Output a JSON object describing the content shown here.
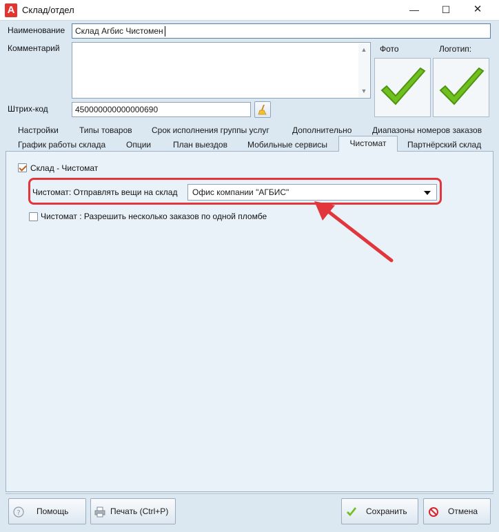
{
  "window": {
    "title": "Склад/отдел",
    "minimize_glyph": "—",
    "maximize_glyph": "☐",
    "close_glyph": "✕"
  },
  "form": {
    "name_label": "Наименование",
    "name_value": "Склад Агбис Чистомен",
    "comment_label": "Комментарий",
    "comment_value": "",
    "barcode_label": "Штрих-код",
    "barcode_value": "450000000000000690",
    "photo_label": "Фото",
    "logo_label": "Логотип:"
  },
  "tabs": {
    "row1": [
      "Настройки",
      "Типы товаров",
      "Срок исполнения группы услуг",
      "Дополнительно",
      "Диапазоны номеров заказов"
    ],
    "row2": [
      "График работы склада",
      "Опции",
      "План выездов",
      "Мобильные сервисы",
      "Чистомат",
      "Партнёрский склад"
    ],
    "active": "Чистомат"
  },
  "chistomat": {
    "enable_label": "Склад - Чистомат",
    "enable_checked": true,
    "send_label": "Чистомат: Отправлять вещи на склад",
    "send_value": "Офис компании \"АГБИС\"",
    "multi_label": "Чистомат : Разрешить несколько заказов по одной пломбе",
    "multi_checked": false
  },
  "buttons": {
    "help": "Помощь",
    "print": "Печать (Ctrl+P)",
    "save": "Сохранить",
    "cancel": "Отмена"
  },
  "colors": {
    "accent_highlight": "#e0363c",
    "check_green": "#6fbf1f",
    "background": "#dbe8f2"
  },
  "icons": {
    "app": "agbis-logo-icon",
    "broom": "broom-icon",
    "photo": "green-checkmark-icon",
    "logo": "green-checkmark-icon",
    "help": "question-circle-icon",
    "print": "printer-icon",
    "save": "checkmark-icon",
    "cancel": "no-entry-icon"
  }
}
